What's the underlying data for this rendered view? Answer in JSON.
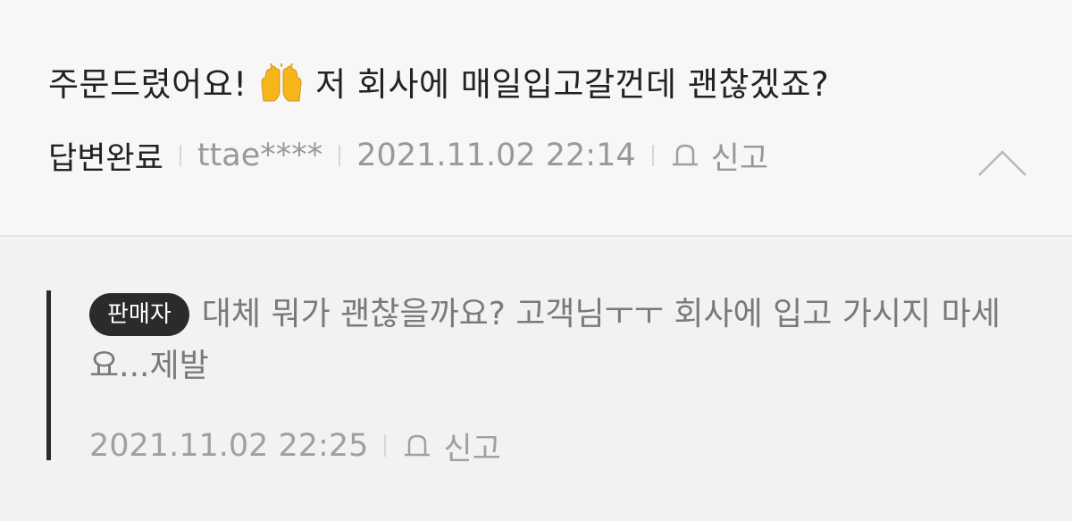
{
  "question": {
    "text_before_emoji": "주문드렸어요! ",
    "emoji_icon": "raising-hands-emoji",
    "text_after_emoji": " 저 회사에 매일입고갈껀데 괜찮겠죠?",
    "status": "답변완료",
    "author": "ttae****",
    "datetime": "2021.11.02 22:14",
    "report_label": "신고"
  },
  "answer": {
    "badge": "판매자",
    "text": "대체 뭐가 괜찮을까요? 고객님ㅜㅜ 회사에 입고 가시지 마세요...제발",
    "datetime": "2021.11.02 22:25",
    "report_label": "신고"
  },
  "colors": {
    "background": "#f7f7f7",
    "answer_background": "#f2f2f2",
    "badge": "#2b2b2b",
    "emoji": "#f5b51b"
  }
}
